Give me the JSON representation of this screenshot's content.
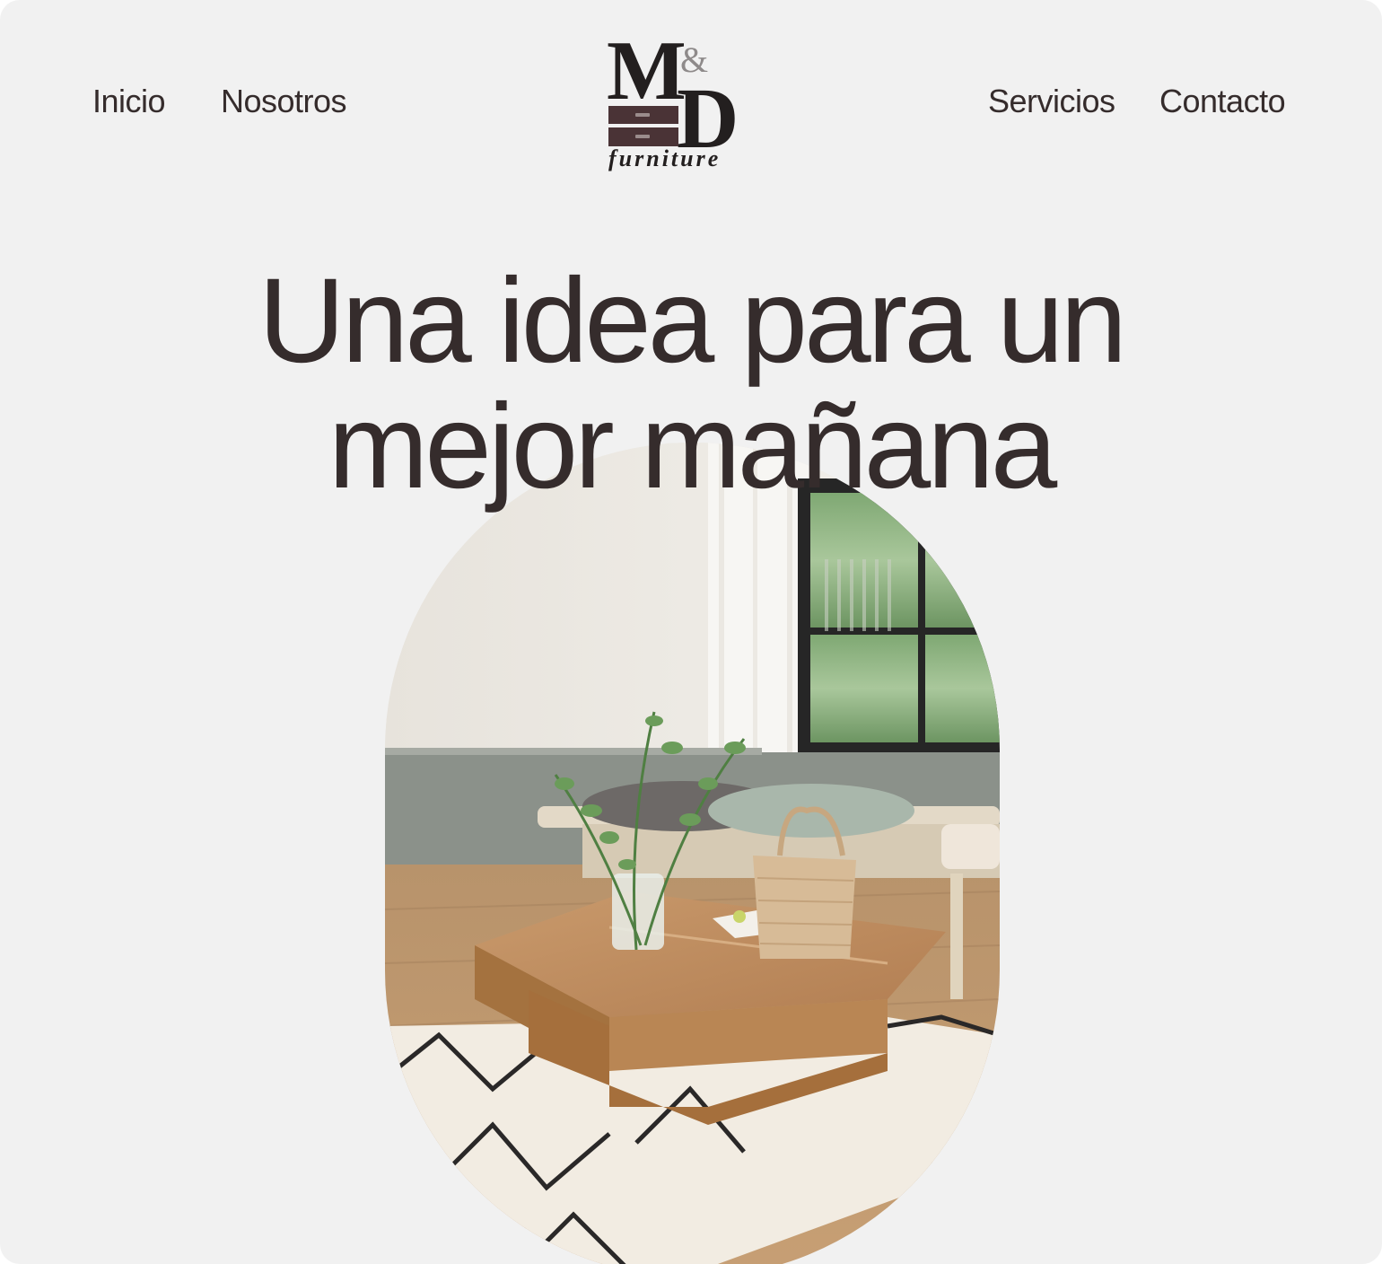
{
  "nav": {
    "left": [
      "Inicio",
      "Nosotros"
    ],
    "right": [
      "Servicios",
      "Contacto"
    ]
  },
  "logo": {
    "monogram_left": "M",
    "ampersand": "&",
    "monogram_right": "D",
    "subtitle": "furniture"
  },
  "hero": {
    "title_line_1": "Una idea para un",
    "title_line_2": "mejor mañana",
    "image_subject": "living-room-photo"
  },
  "colors": {
    "background": "#f1f1f1",
    "text": "#352c2c",
    "logo_dark": "#231f1f",
    "logo_drawer": "#4a3336"
  }
}
